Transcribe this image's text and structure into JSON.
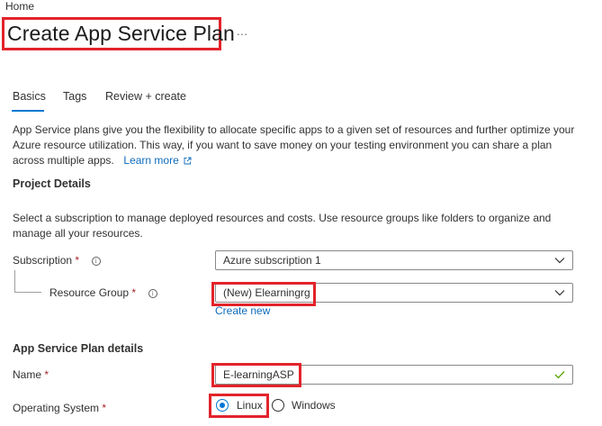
{
  "breadcrumb": "Home",
  "title": "Create App Service Plan",
  "more_label": "...",
  "tabs": [
    {
      "label": "Basics",
      "active": true
    },
    {
      "label": "Tags",
      "active": false
    },
    {
      "label": "Review + create",
      "active": false
    }
  ],
  "description": {
    "text": "App Service plans give you the flexibility to allocate specific apps to a given set of resources and further optimize your Azure resource utilization. This way, if you want to save money on your testing environment you can share a plan across multiple apps.",
    "link": "Learn more"
  },
  "project": {
    "heading": "Project Details",
    "description": "Select a subscription to manage deployed resources and costs. Use resource groups like folders to organize and manage all your resources.",
    "subscription_label": "Subscription",
    "subscription_value": "Azure subscription 1",
    "resource_group_label": "Resource Group",
    "resource_group_value": "(New) Elearningrg",
    "create_new": "Create new"
  },
  "plan": {
    "heading": "App Service Plan details",
    "name_label": "Name",
    "name_value": "E-learningASP",
    "os_label": "Operating System",
    "os_options": [
      "Linux",
      "Windows"
    ],
    "os_selected": "Linux"
  },
  "required_mark": "*",
  "info_glyph": "i",
  "colors": {
    "accent": "#0078d4",
    "link": "#0f6cbd",
    "required": "#a4262c",
    "highlight": "#e3232b",
    "valid": "#57a300"
  },
  "icons": [
    "ellipsis-icon",
    "external-link-icon",
    "info-icon",
    "chevron-down-icon",
    "checkmark-icon",
    "radio-icon"
  ]
}
